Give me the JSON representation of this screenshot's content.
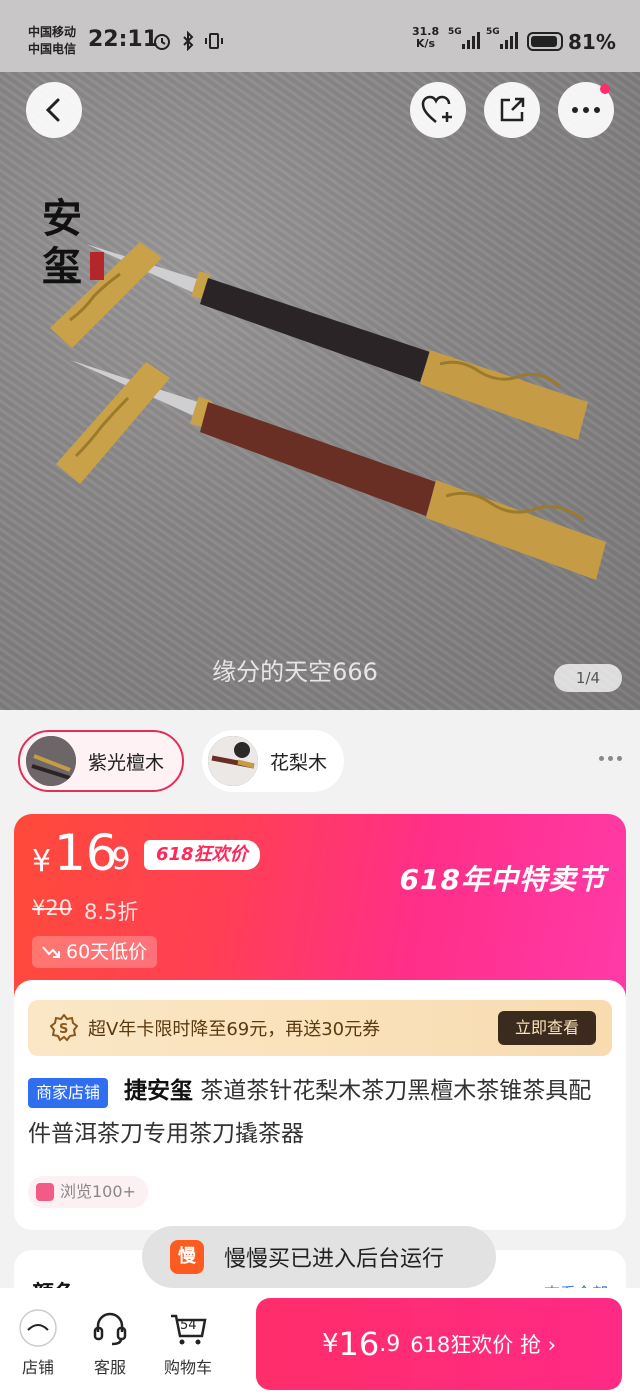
{
  "status_bar": {
    "carrier_1": "中国移动",
    "carrier_2": "中国电信",
    "time": "22:11",
    "net_speed_value": "31.8",
    "net_speed_unit": "K/s",
    "signal_1_label": "5G",
    "signal_2_label": "5G",
    "battery_percent": "81%"
  },
  "hero": {
    "watermark": "缘分的天空666",
    "image_counter": "1/4",
    "brand_logo_text": "捷安玺"
  },
  "variants": [
    {
      "label": "紫光檀木",
      "selected": true
    },
    {
      "label": "花梨木",
      "selected": false
    }
  ],
  "price": {
    "currency": "¥",
    "integer": "16",
    "decimal": ".9",
    "promo_badge": "618狂欢价",
    "festival_title": "618年中特卖节",
    "original_price": "¥20",
    "discount": "8.5折",
    "low_price_tag": "60天低价"
  },
  "vip": {
    "text": "超V年卡限时降至69元，再送30元券",
    "button": "立即查看"
  },
  "product": {
    "store_badge": "商家店铺",
    "brand": "捷安玺",
    "title_rest": " 茶道茶针花梨木茶刀黑檀木茶锥茶具配件普洱茶刀专用茶刀撬茶器",
    "views": "浏览100+"
  },
  "next_section": {
    "title": "颜色",
    "link": "查看全部"
  },
  "toast": {
    "logo": "慢",
    "text": "慢慢买已进入后台运行"
  },
  "bottom_bar": {
    "store_label": "店铺",
    "service_label": "客服",
    "cart_label": "购物车",
    "cart_count": "54",
    "buy_currency": "¥",
    "buy_integer": "16",
    "buy_decimal": ".9",
    "buy_text": "618狂欢价 抢 ›"
  },
  "colors": {
    "accent": "#ff2d6a",
    "store_badge": "#2f6ef0",
    "vip_button": "#3b2a1e"
  }
}
